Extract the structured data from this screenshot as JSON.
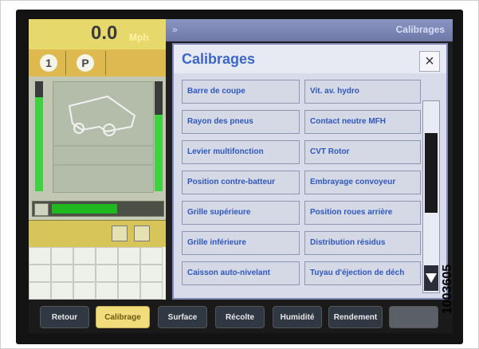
{
  "speedometer": {
    "value": "0.0",
    "unit": "Mph"
  },
  "gears": [
    "1",
    "P"
  ],
  "title_bar": {
    "title": "Calibrages",
    "symbol": "»"
  },
  "dialog": {
    "title": "Calibrages",
    "close_symbol": "×",
    "buttons": [
      "Barre de coupe",
      "Vit. av. hydro",
      "Rayon des pneus",
      "Contact neutre MFH",
      "Levier multifonction",
      "CVT Rotor",
      "Position contre-batteur",
      "Embrayage convoyeur",
      "Grille supérieure",
      "Position roues arrière",
      "Grille inférieure",
      "Distribution résidus",
      "Caisson auto-nivelant",
      "Tuyau d'éjection de déch"
    ]
  },
  "bottom_nav": {
    "buttons": [
      "Retour",
      "Calibrage",
      "Surface",
      "Récolte",
      "Humidité",
      "Rendement",
      ""
    ]
  },
  "side_code": "1003605",
  "colors": {
    "accent": "#3c66c8",
    "panel_yellow": "#e7d86b",
    "active_tab": "#f2dd7c"
  },
  "progress": {
    "percent": 50
  }
}
